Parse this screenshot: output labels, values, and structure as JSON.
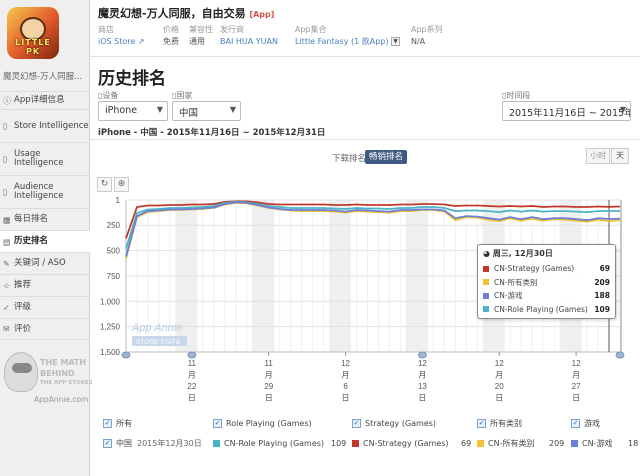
{
  "app": {
    "title": "魔灵幻想-万人同服，自由交易",
    "tag": "[App]",
    "icon_text": "LITTLE PK",
    "sidebar_name": "魔灵幻想-万人同服..."
  },
  "meta": [
    {
      "label": "商店",
      "value": "iOS Store"
    },
    {
      "label": "价格",
      "value": "免费"
    },
    {
      "label": "兼容性",
      "value": "通用"
    },
    {
      "label": "发行商",
      "value": "BAI HUA YUAN"
    },
    {
      "label": "App集合",
      "value": "Little Fantasy (1 款App)"
    },
    {
      "label": "App系列",
      "value": "N/A"
    }
  ],
  "nav": [
    {
      "label": "App详细信息",
      "icon": "info-icon"
    },
    {
      "label": "Store Intelligence",
      "icon": "store-icon"
    },
    {
      "label": "Usage Intelligence",
      "icon": "usage-icon"
    },
    {
      "label": "Audience Intelligence",
      "icon": "audience-icon"
    },
    {
      "label": "每日排名",
      "icon": "calendar-icon"
    },
    {
      "label": "历史排名",
      "icon": "chart-icon"
    },
    {
      "label": "关键词 / ASO",
      "icon": "key-icon"
    },
    {
      "label": "推荐",
      "icon": "star-icon"
    },
    {
      "label": "评级",
      "icon": "rating-icon"
    },
    {
      "label": "评价",
      "icon": "review-icon"
    }
  ],
  "ad": {
    "line1": "THE MATH",
    "line2": "BEHIND",
    "line3": "THE APP STORES",
    "url": "AppAnnie.com"
  },
  "page_title": "历史排名",
  "filters": {
    "device_label": "设备",
    "device_value": "iPhone",
    "country_label": "国家",
    "country_value": "中国",
    "period_label": "时间段",
    "period_value": "2015年11月16日 ~ 2015年..."
  },
  "range_text": "iPhone - 中国 - 2015年11月16日 ~ 2015年12月31日",
  "toggles": {
    "downloads": "下载排名",
    "grossing": "畅销排名",
    "hour": "小时",
    "day": "天"
  },
  "tools": {
    "reset_icon": "↻",
    "zoom_icon": "⊕"
  },
  "watermark": {
    "line1": "App Annie",
    "line2": "STORE STATS"
  },
  "tooltip": {
    "header": "周三, 12月30日",
    "rows": [
      {
        "name": "CN-Strategy (Games)",
        "value": "69",
        "color": "#c0392b"
      },
      {
        "name": "CN-所有类别",
        "value": "209",
        "color": "#f1c232"
      },
      {
        "name": "CN-游戏",
        "value": "188",
        "color": "#6d7fd6"
      },
      {
        "name": "CN-Role Playing (Games)",
        "value": "109",
        "color": "#4bb4c4"
      }
    ]
  },
  "legend": {
    "headers": [
      "所有",
      "Role Playing (Games)",
      "Strategy (Games)",
      "所有类别",
      "游戏"
    ],
    "country": "中国",
    "date": "2015年12月30日",
    "items": [
      {
        "name": "CN-Role Playing (Games)",
        "value": "109",
        "color": "#4bb4c4"
      },
      {
        "name": "CN-Strategy (Games)",
        "value": "69",
        "color": "#c0392b"
      },
      {
        "name": "CN-所有类别",
        "value": "209",
        "color": "#f1c232"
      },
      {
        "name": "CN-游戏",
        "value": "18",
        "color": "#6d7fd6"
      }
    ]
  },
  "chart_data": {
    "type": "line",
    "title": "",
    "xlabel": "",
    "ylabel": "",
    "y_inverted": true,
    "ylim": [
      1,
      1500
    ],
    "y_ticks": [
      "1",
      "250",
      "500",
      "750",
      "1,000",
      "1,250",
      "1,500"
    ],
    "y_tick_values": [
      1,
      250,
      500,
      750,
      1000,
      1250,
      1500
    ],
    "x_ticks": [
      {
        "label": "11\n月\n22\n日",
        "date": "2015-11-22"
      },
      {
        "label": "11\n月\n29\n日",
        "date": "2015-11-29"
      },
      {
        "label": "12\n月\n6\n日",
        "date": "2015-12-06"
      },
      {
        "label": "12\n月\n13\n日",
        "date": "2015-12-13"
      },
      {
        "label": "12\n月\n20\n日",
        "date": "2015-12-20"
      },
      {
        "label": "12\n月\n27\n日",
        "date": "2015-12-27"
      }
    ],
    "x_dates": [
      "2015-11-16",
      "2015-11-17",
      "2015-11-18",
      "2015-11-19",
      "2015-11-20",
      "2015-11-21",
      "2015-11-22",
      "2015-11-23",
      "2015-11-24",
      "2015-11-25",
      "2015-11-26",
      "2015-11-27",
      "2015-11-28",
      "2015-11-29",
      "2015-11-30",
      "2015-12-01",
      "2015-12-02",
      "2015-12-03",
      "2015-12-04",
      "2015-12-05",
      "2015-12-06",
      "2015-12-07",
      "2015-12-08",
      "2015-12-09",
      "2015-12-10",
      "2015-12-11",
      "2015-12-12",
      "2015-12-13",
      "2015-12-14",
      "2015-12-15",
      "2015-12-16",
      "2015-12-17",
      "2015-12-18",
      "2015-12-19",
      "2015-12-20",
      "2015-12-21",
      "2015-12-22",
      "2015-12-23",
      "2015-12-24",
      "2015-12-25",
      "2015-12-26",
      "2015-12-27",
      "2015-12-28",
      "2015-12-29",
      "2015-12-30",
      "2015-12-31"
    ],
    "series": [
      {
        "name": "CN-Strategy (Games)",
        "color": "#c0392b",
        "values": [
          380,
          70,
          55,
          55,
          50,
          50,
          45,
          45,
          40,
          20,
          15,
          15,
          25,
          40,
          45,
          45,
          45,
          45,
          45,
          50,
          50,
          45,
          50,
          50,
          50,
          45,
          45,
          40,
          40,
          45,
          60,
          55,
          55,
          60,
          65,
          60,
          65,
          60,
          70,
          65,
          65,
          70,
          70,
          65,
          69,
          65
        ]
      },
      {
        "name": "CN-Role Playing (Games)",
        "color": "#4bb4c4",
        "values": [
          480,
          130,
          95,
          90,
          80,
          80,
          75,
          70,
          60,
          30,
          20,
          25,
          40,
          60,
          70,
          80,
          80,
          80,
          80,
          85,
          90,
          80,
          85,
          85,
          90,
          80,
          80,
          70,
          70,
          80,
          110,
          105,
          105,
          110,
          120,
          105,
          115,
          105,
          115,
          110,
          110,
          115,
          120,
          110,
          109,
          110
        ]
      },
      {
        "name": "CN-所有类别",
        "color": "#f1c232",
        "values": [
          580,
          170,
          120,
          110,
          100,
          100,
          95,
          90,
          80,
          45,
          30,
          35,
          55,
          80,
          95,
          105,
          110,
          110,
          110,
          115,
          125,
          110,
          115,
          120,
          125,
          110,
          110,
          100,
          100,
          115,
          200,
          170,
          175,
          195,
          210,
          180,
          205,
          185,
          205,
          190,
          195,
          205,
          215,
          195,
          209,
          200
        ]
      },
      {
        "name": "CN-游戏",
        "color": "#6d7fd6",
        "values": [
          560,
          160,
          110,
          105,
          95,
          95,
          90,
          85,
          75,
          40,
          25,
          30,
          50,
          75,
          90,
          100,
          100,
          100,
          100,
          105,
          115,
          100,
          105,
          110,
          115,
          100,
          100,
          95,
          95,
          105,
          180,
          160,
          165,
          180,
          195,
          170,
          190,
          170,
          190,
          180,
          180,
          190,
          200,
          180,
          188,
          185
        ]
      }
    ],
    "grid": true,
    "legend_position": "bottom"
  }
}
